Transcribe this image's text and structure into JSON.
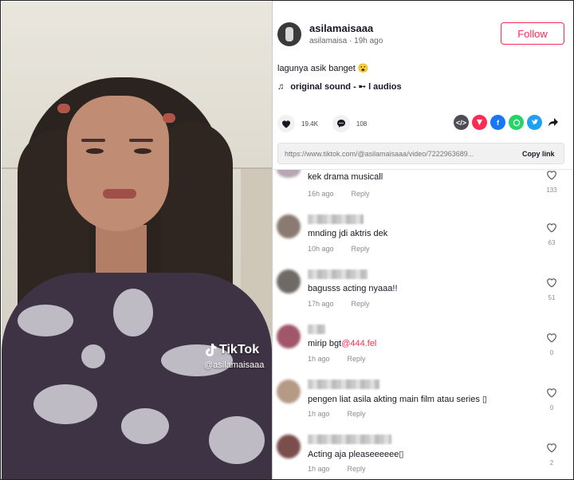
{
  "watermark": {
    "brand": "TikTok",
    "handle": "@asilamaisaaa"
  },
  "post": {
    "username": "asilamaisaaa",
    "meta": "asilamaisa · 19h ago",
    "follow_label": "Follow",
    "caption": "lagunya asik banget 😮",
    "sound_icon": "♫",
    "sound": "original sound - ➸ l audios",
    "likes": "19.4K",
    "comments": "108",
    "share_icons": [
      "embed-icon",
      "send-icon",
      "facebook-icon",
      "whatsapp-icon",
      "twitter-icon",
      "share-arrow-icon"
    ],
    "link": "https://www.tiktok.com/@asilamaisaaa/video/72229636​89...",
    "copy_label": "Copy link"
  },
  "comments": [
    {
      "text": "kek drama musicall",
      "time": "16h ago",
      "reply": "Reply",
      "likes": "133"
    },
    {
      "text": "mnding jdi aktris dek",
      "time": "10h ago",
      "reply": "Reply",
      "likes": "63"
    },
    {
      "text": "bagusss acting nyaaa!!",
      "time": "17h ago",
      "reply": "Reply",
      "likes": "51"
    },
    {
      "text": "mirip bgt",
      "mention": "@444.fel",
      "time": "1h ago",
      "reply": "Reply",
      "likes": "0"
    },
    {
      "text": "pengen liat asila akting main film atau series ▯",
      "time": "1h ago",
      "reply": "Reply",
      "likes": "0"
    },
    {
      "text": "Acting aja pleaseeeeee▯",
      "time": "1h ago",
      "reply": "Reply",
      "likes": "2"
    }
  ],
  "colors": {
    "accent": "#fe2c55",
    "text": "#161823",
    "muted": "#8a8b91"
  }
}
